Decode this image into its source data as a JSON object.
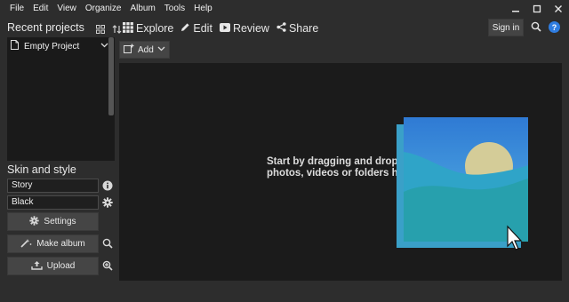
{
  "menu": [
    "File",
    "Edit",
    "View",
    "Organize",
    "Album",
    "Tools",
    "Help"
  ],
  "window_controls": {
    "minimize": "minimize-icon",
    "maximize": "maximize-icon",
    "close": "close-icon"
  },
  "recent": {
    "title": "Recent projects",
    "items": [
      {
        "label": "Empty Project"
      }
    ]
  },
  "skin": {
    "title": "Skin and style",
    "skin_value": "Story",
    "style_value": "Black"
  },
  "buttons": {
    "settings": "Settings",
    "make_album": "Make album",
    "upload": "Upload",
    "add": "Add",
    "sign_in": "Sign in"
  },
  "toolbar": {
    "explore": "Explore",
    "edit": "Edit",
    "review": "Review",
    "share": "Share"
  },
  "help_glyph": "?",
  "drop": {
    "line1": "Start by dragging and dropping",
    "line2": "photos, videos or folders here"
  },
  "colors": {
    "accent": "#2f7de1",
    "panel": "#1b1b1b",
    "background": "#2d2d2d"
  }
}
